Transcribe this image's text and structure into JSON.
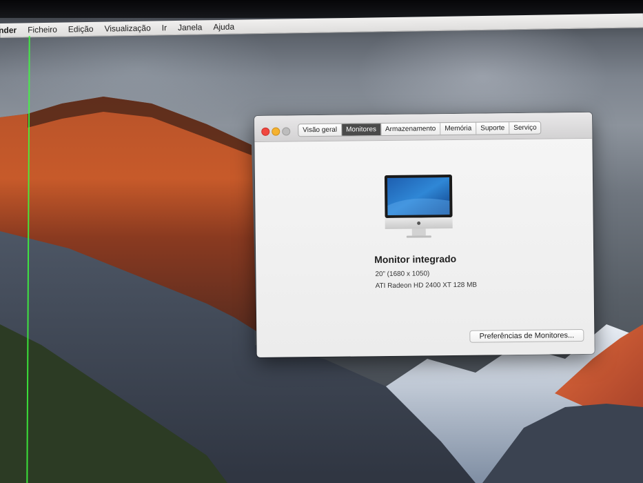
{
  "menubar": {
    "app_name": "nder",
    "items": [
      "Ficheiro",
      "Edição",
      "Visualização",
      "Ir",
      "Janela",
      "Ajuda"
    ]
  },
  "window": {
    "tabs": [
      {
        "label": "Visão geral",
        "active": false
      },
      {
        "label": "Monitores",
        "active": true
      },
      {
        "label": "Armazenamento",
        "active": false
      },
      {
        "label": "Memória",
        "active": false
      },
      {
        "label": "Suporte",
        "active": false
      },
      {
        "label": "Serviço",
        "active": false
      }
    ],
    "display_name": "Monitor integrado",
    "display_size": "20” (1680 x 1050)",
    "graphics": "ATI Radeon HD 2400 XT 128 MB",
    "prefs_button": "Preferências de Monitores..."
  },
  "colors": {
    "close": "#f0473f",
    "minimize": "#f5b22f",
    "zoom": "#bdbdbd",
    "active_tab": "#4a4a4a"
  }
}
